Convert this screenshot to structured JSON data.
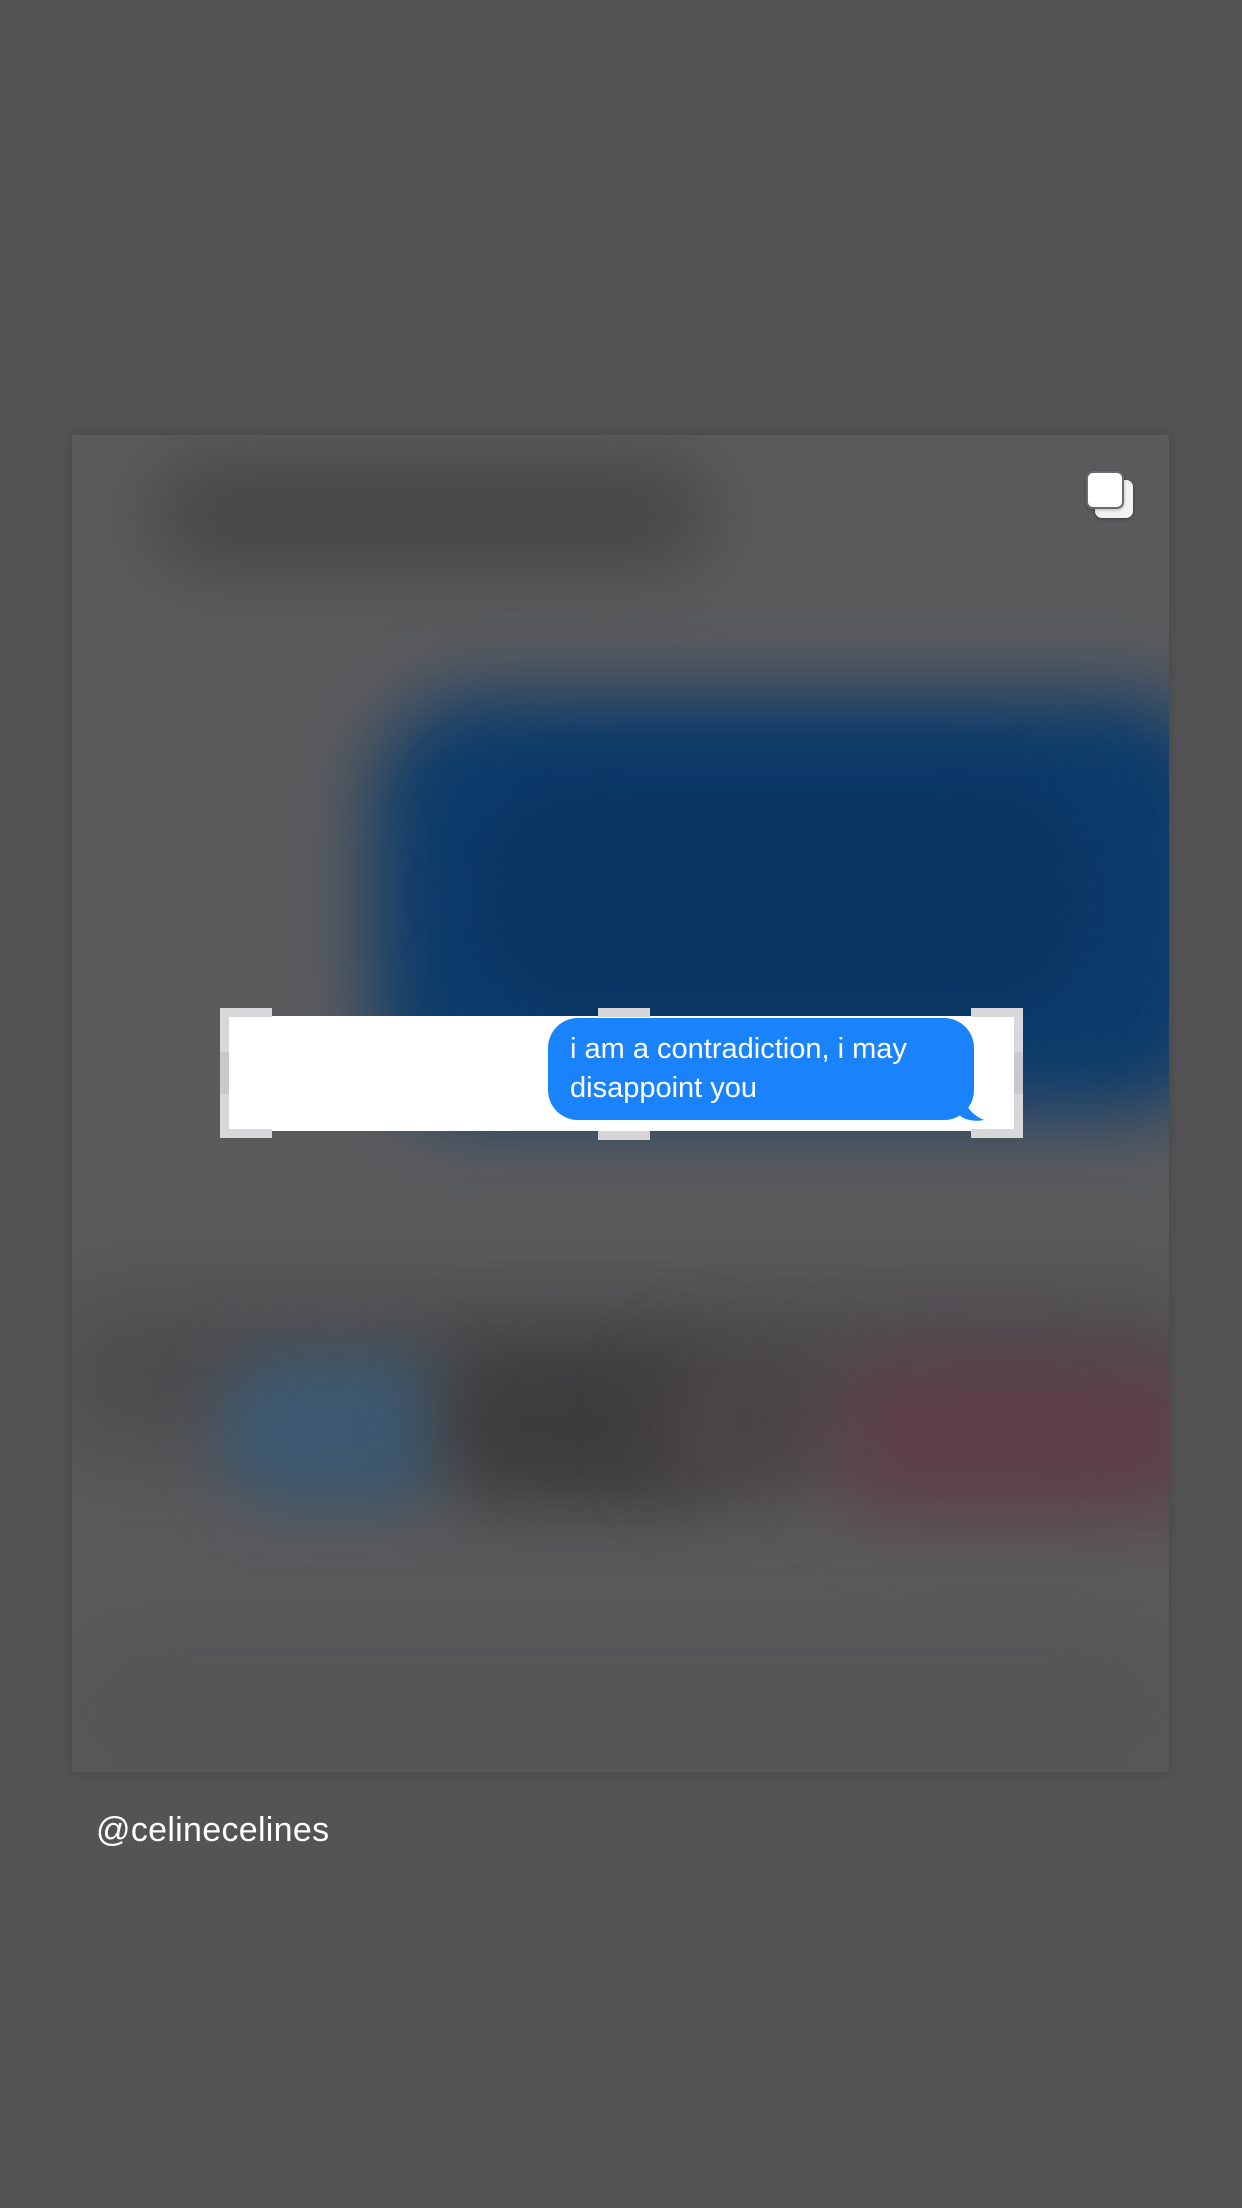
{
  "story": {
    "message_bubble": {
      "text_line1": "i am a contradiction, i may",
      "text_line2": "disappoint you",
      "bubble_color": "#1a82fb",
      "text_color": "#ffffff"
    },
    "username": "@celinecelines",
    "multiple_photos_icon": "multiple-photos-icon",
    "background_color": "#545456"
  }
}
